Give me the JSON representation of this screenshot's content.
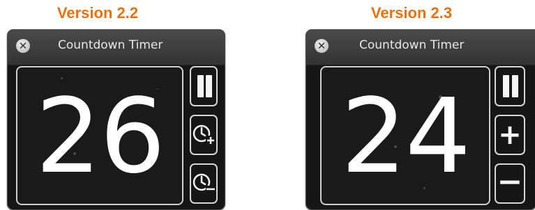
{
  "versions": [
    {
      "heading": "Version 2.2",
      "window_title": "Countdown Timer",
      "countdown": "26",
      "buttons": [
        "pause",
        "add-time (clock with plus)",
        "subtract-time (clock with minus)"
      ]
    },
    {
      "heading": "Version 2.3",
      "window_title": "Countdown Timer",
      "countdown": "24",
      "buttons": [
        "pause",
        "plus",
        "minus"
      ]
    }
  ],
  "colors": {
    "heading": "#e8710a",
    "widget_bg": "#161616",
    "titlebar": "#3e3e3e",
    "digit": "#ffffff",
    "border": "#d6d6d6"
  },
  "icons": {
    "close": "close-circle-x-icon",
    "pause": "pause-icon",
    "clock_plus": "clock-plus-icon",
    "clock_minus": "clock-minus-icon",
    "plus": "plus-icon",
    "minus": "minus-icon"
  }
}
